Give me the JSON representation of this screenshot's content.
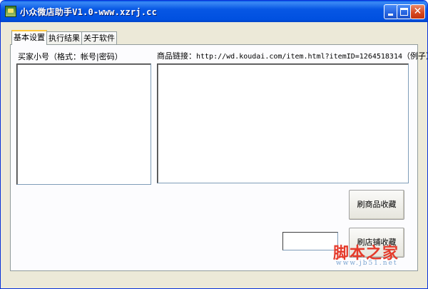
{
  "window": {
    "title": "小众微店助手V1.0-www.xzrj.cc",
    "icon": "app-icon"
  },
  "titlebar_buttons": {
    "minimize": "minimize-icon",
    "maximize": "maximize-icon",
    "close": "✕"
  },
  "tabs": [
    {
      "label": "基本设置",
      "active": true
    },
    {
      "label": "执行结果",
      "active": false
    },
    {
      "label": "关于软件",
      "active": false
    }
  ],
  "main": {
    "accounts_label": "买家小号（格式：帐号|密码）",
    "product_link_label_prefix": "商品链接：",
    "product_link_example_url": "http://wd.koudai.com/item.html?itemID=1264518314",
    "product_link_example_suffix": "（例子）",
    "accounts_value": "",
    "product_links_value": "",
    "count_value": ""
  },
  "buttons": {
    "favorite_product": "刷商品收藏",
    "favorite_shop": "刷店铺收藏"
  },
  "watermark": {
    "main": "脚本之家",
    "sub": "www.jb51.net"
  },
  "colors": {
    "titlebar": "#0054e3",
    "accent_tab": "#ffc83c",
    "watermark": "#e53a2b"
  }
}
